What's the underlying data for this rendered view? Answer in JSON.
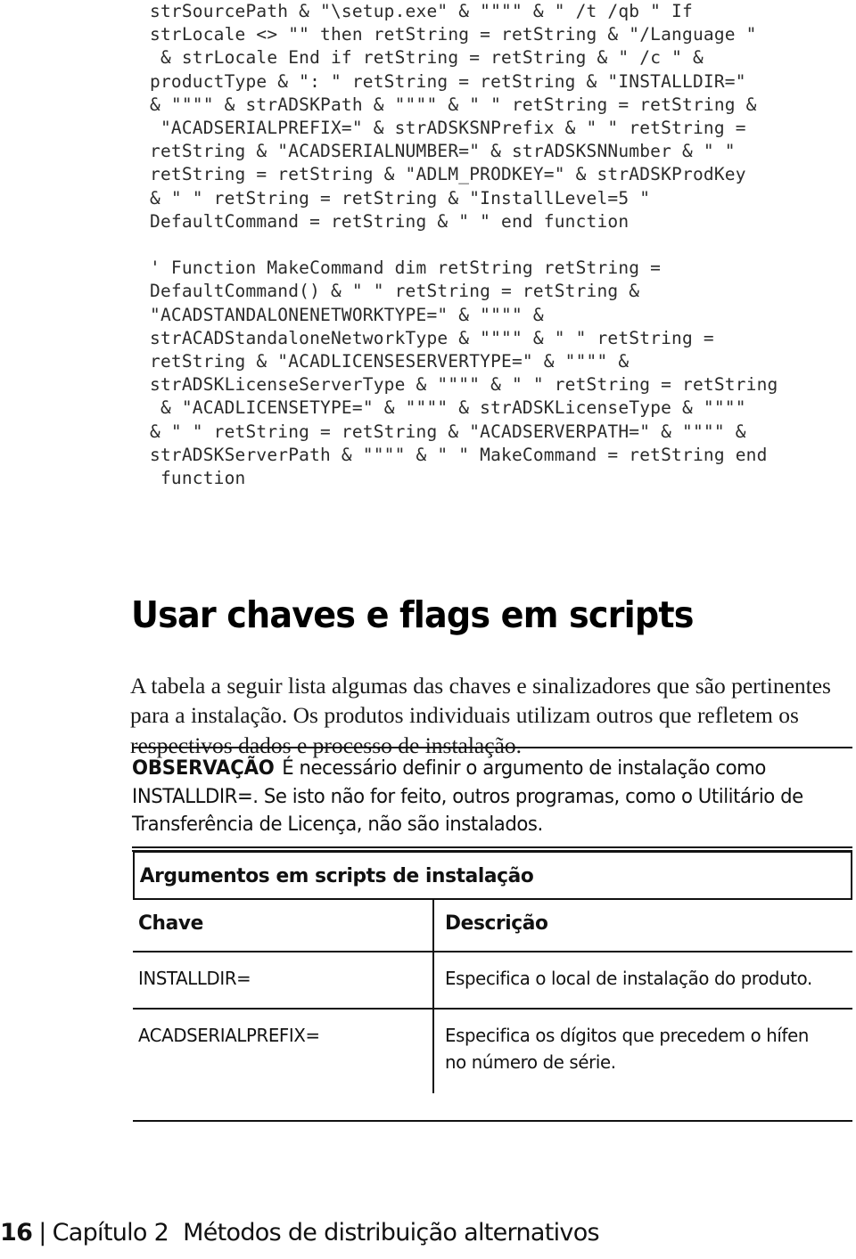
{
  "code_block": {
    "lines": [
      "strSourcePath & \"\\setup.exe\" & \"\"\"\" & \" /t /qb \" If",
      "strLocale <> \"\" then retString = retString & \"/Language \"",
      " & strLocale End if retString = retString & \" /c \" &",
      "productType & \": \" retString = retString & \"INSTALLDIR=\"",
      "& \"\"\"\" & strADSKPath & \"\"\"\" & \" \" retString = retString &",
      " \"ACADSERIALPREFIX=\" & strADSKSNPrefix & \" \" retString =",
      "retString & \"ACADSERIALNUMBER=\" & strADSKSNNumber & \" \"",
      "retString = retString & \"ADLM_PRODKEY=\" & strADSKProdKey",
      "& \" \" retString = retString & \"InstallLevel=5 \"",
      "DefaultCommand = retString & \" \" end function",
      "",
      "' Function MakeCommand dim retString retString =",
      "DefaultCommand() & \" \" retString = retString &",
      "\"ACADSTANDALONENETWORKTYPE=\" & \"\"\"\" &",
      "strACADStandaloneNetworkType & \"\"\"\" & \" \" retString =",
      "retString & \"ACADLICENSESERVERTYPE=\" & \"\"\"\" &",
      "strADSKLicenseServerType & \"\"\"\" & \" \" retString = retString",
      " & \"ACADLICENSETYPE=\" & \"\"\"\" & strADSKLicenseType & \"\"\"\"",
      "& \" \" retString = retString & \"ACADSERVERPATH=\" & \"\"\"\" &",
      "strADSKServerPath & \"\"\"\" & \" \" MakeCommand = retString end",
      " function"
    ]
  },
  "section": {
    "heading": "Usar chaves e flags em scripts",
    "intro": "A tabela a seguir lista algumas das chaves e sinalizadores que são pertinentes para a instalação. Os produtos individuais utilizam outros que refletem os respectivos dados e processo de instalação."
  },
  "note": {
    "label": "OBSERVAÇÃO",
    "text": "É necessário definir o argumento de instalação como INSTALLDIR=. Se isto não for feito, outros programas, como o Utilitário de Transferência de Licença, não são instalados."
  },
  "table": {
    "caption": "Argumentos em scripts de instalação",
    "headers": [
      "Chave",
      "Descrição"
    ],
    "rows": [
      {
        "key": "INSTALLDIR=",
        "description": "Especifica o local de instalação do produto."
      },
      {
        "key": "ACADSERIALPREFIX=",
        "description": "Especifica os dígitos que precedem o hífen no número de série."
      }
    ]
  },
  "footer": {
    "page_number": "16",
    "separator": "|",
    "chapter": "Capítulo 2",
    "title": "Métodos de distribuição alternativos"
  },
  "colors": {
    "text": "#111111",
    "code_text": "#2b2b2b",
    "rule": "#111111",
    "background": "#ffffff"
  }
}
